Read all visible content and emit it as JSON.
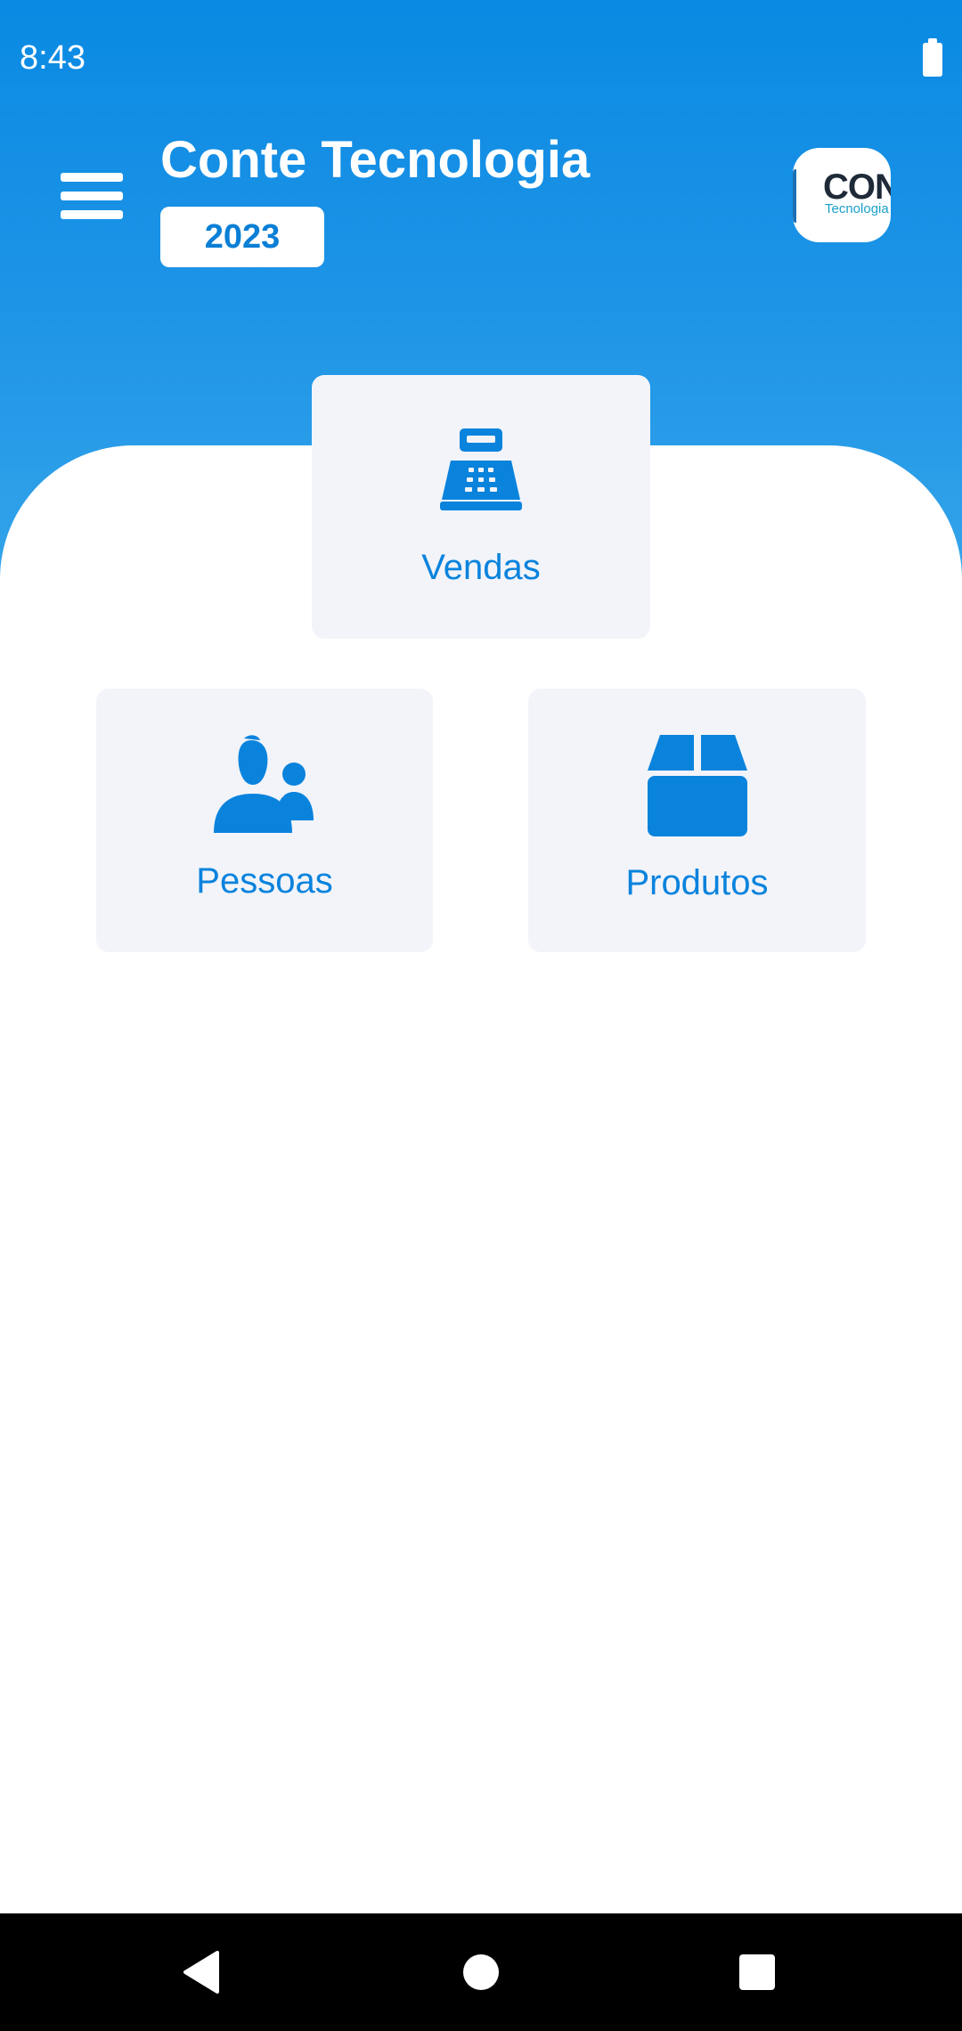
{
  "status_bar": {
    "time": "8:43"
  },
  "header": {
    "title": "Conte Tecnologia",
    "year": "2023",
    "logo": {
      "text_main": "CON",
      "text_sub": "Tecnologia"
    }
  },
  "tiles": [
    {
      "label": "Vendas",
      "icon": "cash-register-icon"
    },
    {
      "label": "Pessoas",
      "icon": "users-icon"
    },
    {
      "label": "Produtos",
      "icon": "box-icon"
    }
  ],
  "colors": {
    "primary": "#0a8ae3",
    "tile_bg": "#f2f4f9",
    "accent_text": "#0a83dd"
  }
}
